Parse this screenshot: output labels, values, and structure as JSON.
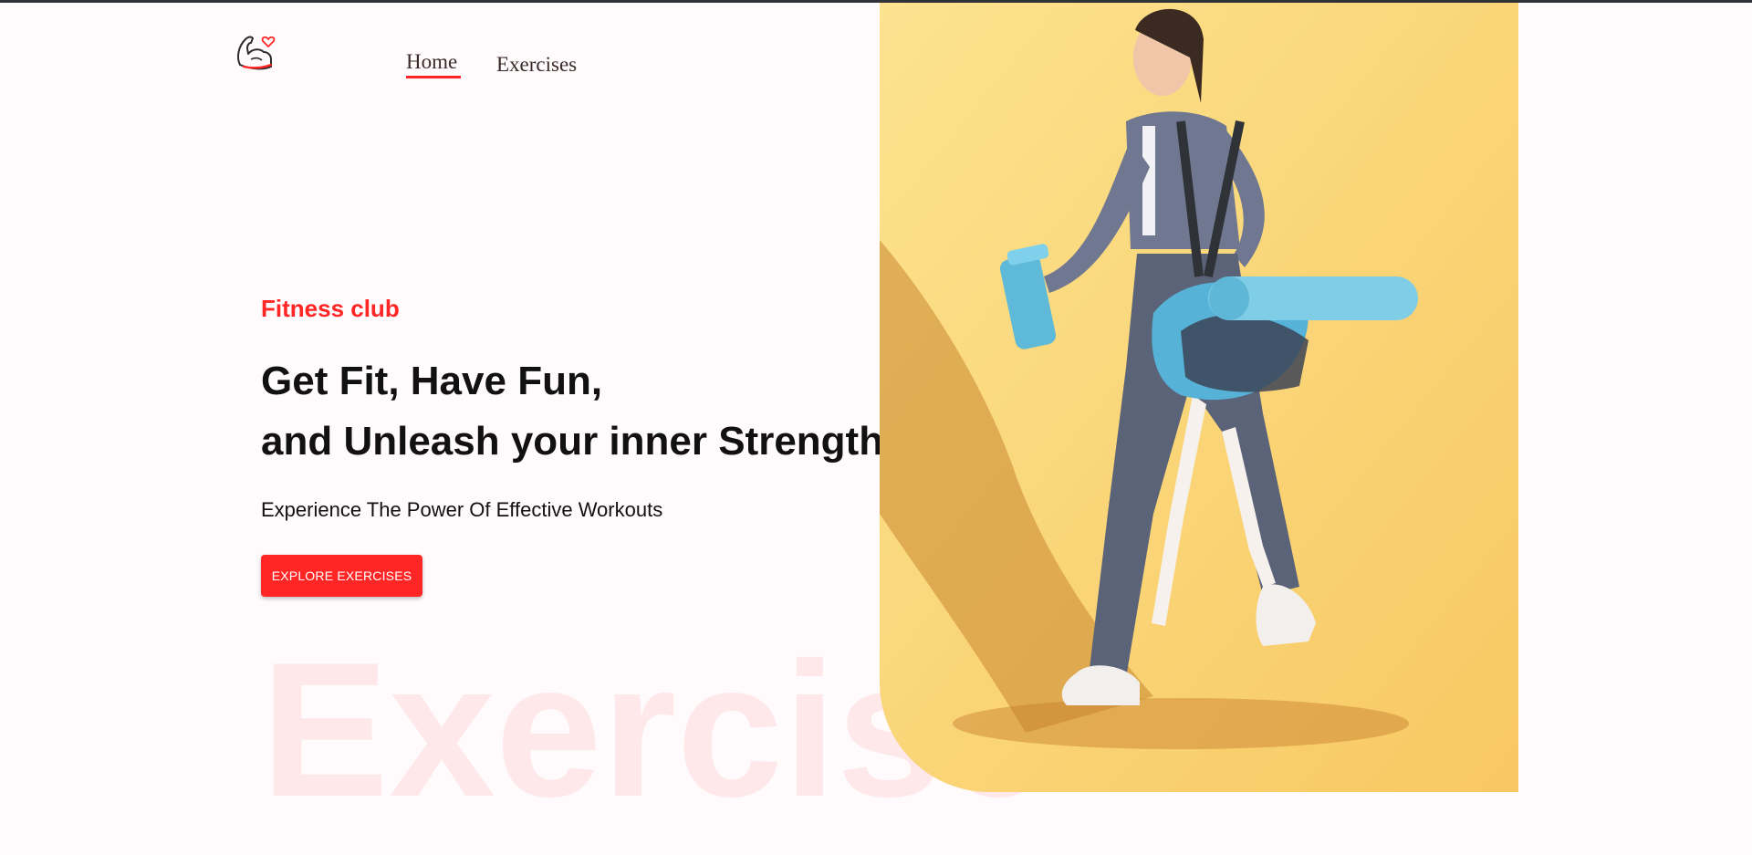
{
  "nav": {
    "logo_icon": "flexed-arm-heart-icon",
    "home_label": "Home",
    "exercises_label": "Exercises"
  },
  "hero": {
    "kicker": "Fitness club",
    "headline_line1": "Get Fit, Have Fun,",
    "headline_line2": "and Unleash your inner Strength",
    "subline": "Experience The Power Of Effective Workouts",
    "cta_label": "EXPLORE EXERCISES",
    "watermark": "Exercise",
    "image_subject": "woman-walking-with-gym-bag-and-shaker"
  },
  "colors": {
    "accent": "#ff2625",
    "background": "#fffafb",
    "image_background": "#fbd372"
  }
}
